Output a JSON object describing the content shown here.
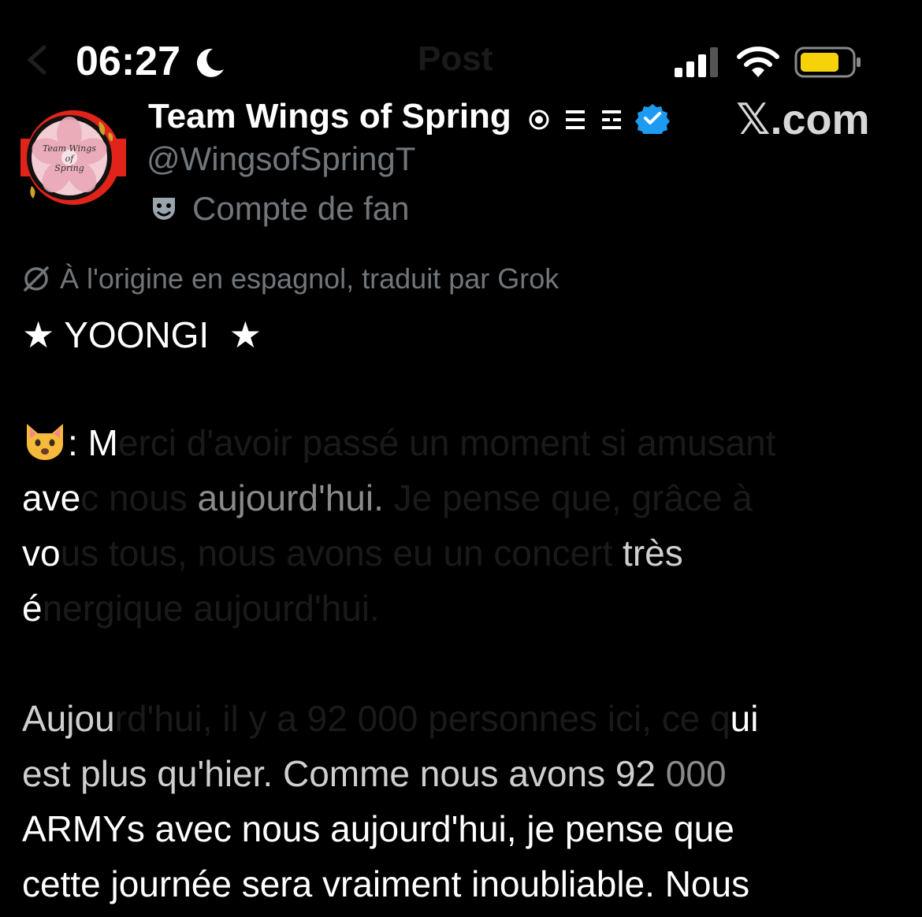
{
  "status_bar": {
    "time": "06:27",
    "moon_icon": "moon-icon",
    "signal_icon": "cellular-signal-icon",
    "wifi_icon": "wifi-icon",
    "battery_icon": "battery-icon",
    "battery_color": "#f5d20a"
  },
  "nav": {
    "title": "Post",
    "back_icon": "back-arrow-icon"
  },
  "profile": {
    "display_name": "Team Wings of Spring",
    "handle": "@WingsofSpringT",
    "fan_label": "Compte de fan",
    "verified_color": "#1d9bf0",
    "avatar_text": "Team Wings of Spring"
  },
  "watermark": {
    "brand": "𝕏.com"
  },
  "translation": {
    "note": "À l'origine en espagnol, traduit par Grok"
  },
  "post": {
    "heading": "★ YOONGI  ★",
    "p1": {
      "l1a": ": M",
      "l1b": "erci d'avoir passé un moment si amusant",
      "l2a": "ave",
      "l2b": "c nous ",
      "l2c": "aujourd'hui.",
      "l2d": " Je pense que, grâce à",
      "l3a": "vo",
      "l3b": "us tous, nous avons eu un concert ",
      "l3c": "très",
      "l4a": "é",
      "l4b": "nergique aujourd'hui."
    },
    "p2": {
      "l1a": "Aujou",
      "l1b": "rd'hui, il y a 92 000 personnes ici, ce q",
      "l1c": "ui",
      "l2a": "est plus qu'hier. Comme nous avons 92 ",
      "l2b": "000",
      "l3": "ARMYs avec nous aujourd'hui, je pense que",
      "l4": "cette journée sera vraiment inoubliable. Nous"
    }
  }
}
